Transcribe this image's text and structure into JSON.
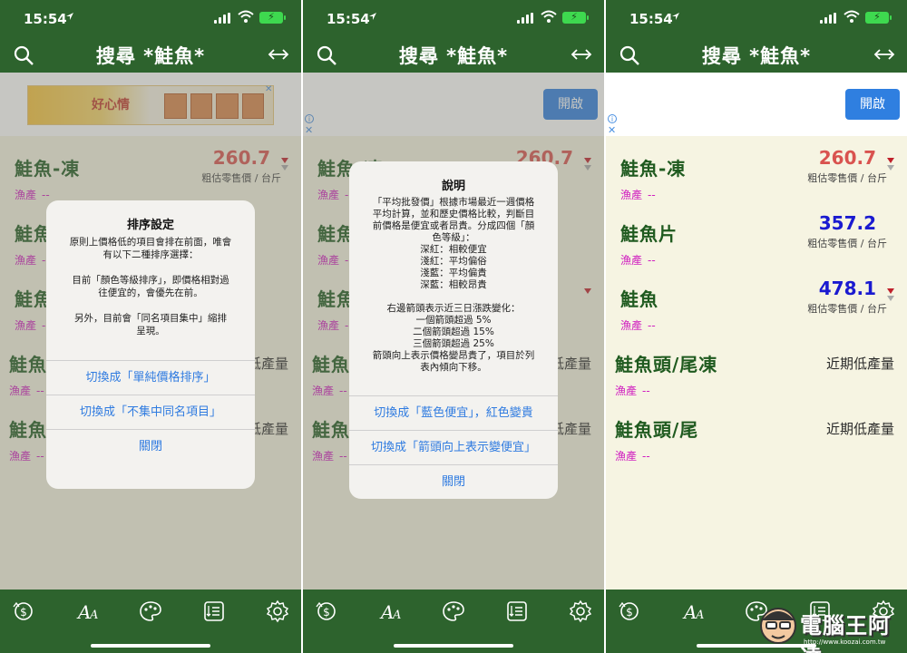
{
  "status": {
    "time": "15:54",
    "battery_icon": "battery-charging-icon"
  },
  "nav": {
    "title": "搜尋 *鮭魚*"
  },
  "ad": {
    "open_label": "開啟",
    "banner_text": "好心情",
    "info_glyph": "i",
    "close_glyph": "✕"
  },
  "items": [
    {
      "name": "鮭魚-凍",
      "category": "漁產",
      "dash": "--",
      "price": "260.7",
      "price_color": "#d9534f",
      "sub": "粗估零售價 / 台斤",
      "arrow": "down-red"
    },
    {
      "name": "鮭魚片",
      "category": "漁產",
      "dash": "--",
      "price": "357.2",
      "price_color": "#1a1ad0",
      "sub": "粗估零售價 / 台斤",
      "arrow": "none"
    },
    {
      "name": "鮭魚",
      "category": "漁產",
      "dash": "--",
      "price": "478.1",
      "price_color": "#1a1ad0",
      "sub": "粗估零售價 / 台斤",
      "arrow": "down-red"
    },
    {
      "name": "鮭魚頭/尾凍",
      "category": "漁產",
      "dash": "--",
      "low": "近期低產量"
    },
    {
      "name": "鮭魚頭/尾",
      "category": "漁產",
      "dash": "--",
      "low": "近期低產量"
    }
  ],
  "alert1": {
    "title": "排序設定",
    "message": "原則上價格低的項目會排在前面，唯會\n有以下二種排序選擇：\n\n目前「顏色等級排序」，即價格相對過\n往便宜的，會優先在前。\n\n另外，目前會「同名項目集中」縮排\n呈現。",
    "buttons": [
      "切換成「單純價格排序」",
      "切換成「不集中同名項目」",
      "關閉"
    ]
  },
  "alert2": {
    "title": "說明",
    "message": "「平均批發價」根據市場最近一週價格\n平均計算，並和歷史價格比較，判斷目\n前價格是便宜或者昂貴。分成四個「顏\n色等級」：\n深紅：相較便宜\n淺紅：平均偏俗\n淺藍：平均偏貴\n深藍：相較昂貴\n\n右邊箭頭表示近三日漲跌變化：\n一個箭頭超過  5%\n二個箭頭超過 15%\n三個箭頭超過 25%\n箭頭向上表示價格變昂貴了，項目於列\n表內傾向下移。",
    "buttons": [
      "切換成「藍色便宜」，紅色變貴",
      "切換成「箭頭向上表示變便宜」",
      "關閉"
    ]
  },
  "tabs": [
    "price-trend-icon",
    "font-size-icon",
    "palette-icon",
    "sort-list-icon",
    "settings-gear-icon"
  ],
  "watermark": {
    "text": "電腦王阿達",
    "url": "http://www.koozai.com.tw"
  }
}
